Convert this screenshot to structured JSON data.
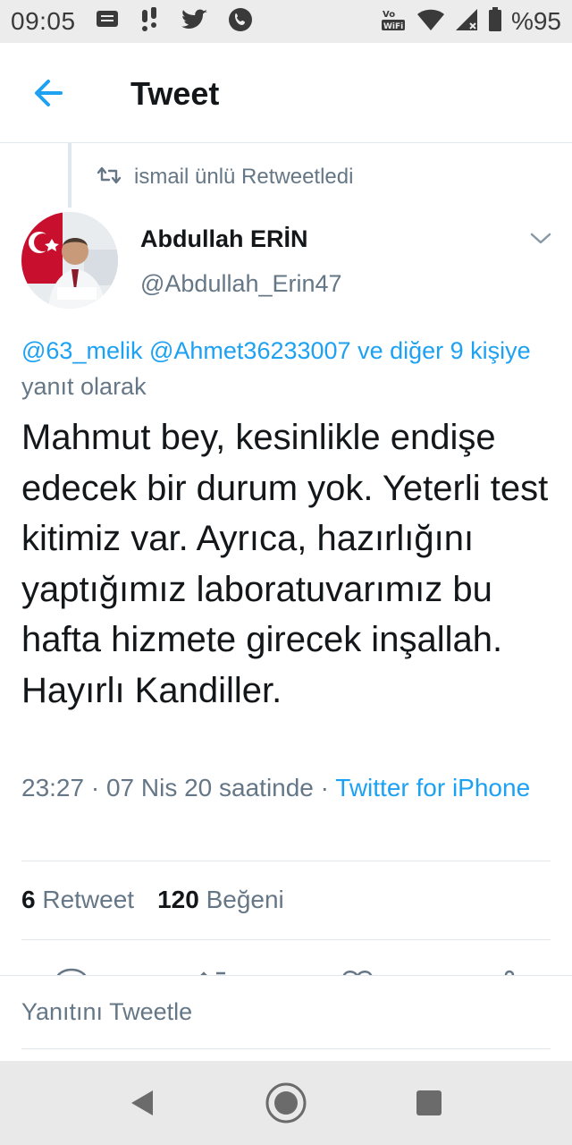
{
  "status_bar": {
    "time": "09:05",
    "battery": "%95",
    "notification_icons": [
      "message-icon",
      "tips-icon",
      "twitter-bird-icon",
      "phone-icon"
    ],
    "system_icons": [
      "volte-wifi-icon",
      "wifi-icon",
      "signal-icon",
      "battery-icon"
    ]
  },
  "header": {
    "title": "Tweet",
    "accent_color": "#1da1f2"
  },
  "retweet": {
    "label": "ismail ünlü Retweetledi"
  },
  "author": {
    "name": "Abdullah ERİN",
    "handle": "@Abdullah_Erin47"
  },
  "reply_to": {
    "mention_1": "@63_melik",
    "mention_2": "@Ahmet36233007",
    "and_others": "ve diğer 9 kişiye",
    "suffix": "yanıt olarak"
  },
  "tweet": {
    "text": "Mahmut bey, kesinlikle endişe edecek bir durum yok. Yeterli test kitimiz var. Ayrıca, hazırlığını yaptığımız laboratuvarımız bu hafta hizmete girecek inşallah. Hayırlı Kandiller.",
    "timestamp": "23:27 · 07 Nis 20 saatinde ·",
    "source": "Twitter for iPhone"
  },
  "stats": {
    "retweet_count": "6",
    "retweet_label": "Retweet",
    "like_count": "120",
    "like_label": "Beğeni"
  },
  "composer": {
    "placeholder": "Yanıtını Tweetle"
  },
  "colors": {
    "link": "#1da1f2",
    "secondary_text": "#657786",
    "primary_text": "#14171a",
    "divider": "#e1e8ed"
  }
}
